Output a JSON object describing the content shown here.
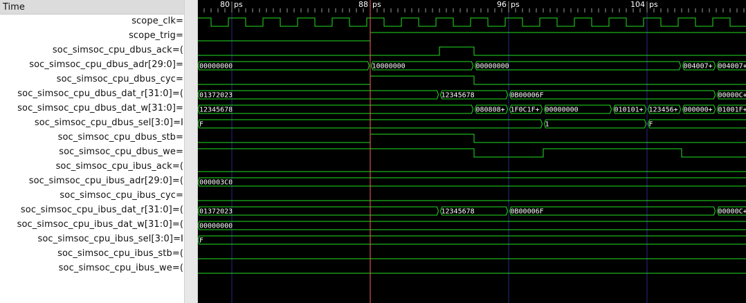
{
  "header": {
    "title": "Time"
  },
  "time_axis": {
    "unit": "ps",
    "major_labels": [
      {
        "time": 80,
        "label": "80"
      },
      {
        "time": 88,
        "label": "88"
      },
      {
        "time": 96,
        "label": "96"
      },
      {
        "time": 104,
        "label": "104"
      }
    ]
  },
  "marker_time": 88,
  "colors": {
    "wave": "#22e022",
    "marker": "#ff6060",
    "grid": "#2a2a80",
    "background": "#000000"
  },
  "signals": [
    {
      "name": "scope_clk",
      "suffix": "=",
      "type": "clock",
      "period": 2,
      "first_rise": 76.8
    },
    {
      "name": "scope_trig",
      "suffix": "=",
      "type": "bit",
      "initial": 0,
      "transitions": [
        {
          "t": 88,
          "v": 1
        }
      ]
    },
    {
      "name": "soc_simsoc_cpu_dbus_ack",
      "suffix": "=(",
      "type": "bit",
      "initial": 0,
      "transitions": [
        {
          "t": 92,
          "v": 1
        },
        {
          "t": 94,
          "v": 0
        }
      ]
    },
    {
      "name": "soc_simsoc_cpu_dbus_adr[29:0]",
      "suffix": "=",
      "type": "bus",
      "segments": [
        {
          "t": 78,
          "v": "00000000"
        },
        {
          "t": 88,
          "v": "10000000"
        },
        {
          "t": 94,
          "v": "00000000"
        },
        {
          "t": 106,
          "v": "004007+"
        },
        {
          "t": 108,
          "v": "004007+"
        }
      ]
    },
    {
      "name": "soc_simsoc_cpu_dbus_cyc",
      "suffix": "=",
      "type": "bit",
      "initial": 0,
      "transitions": [
        {
          "t": 88,
          "v": 1
        },
        {
          "t": 94,
          "v": 0
        }
      ]
    },
    {
      "name": "soc_simsoc_cpu_dbus_dat_r[31:0]",
      "suffix": "=(",
      "type": "bus",
      "segments": [
        {
          "t": 78,
          "v": "01372023"
        },
        {
          "t": 92,
          "v": "12345678"
        },
        {
          "t": 96,
          "v": "0B00006F"
        },
        {
          "t": 108,
          "v": "00000C+"
        }
      ]
    },
    {
      "name": "soc_simsoc_cpu_dbus_dat_w[31:0]",
      "suffix": "=",
      "type": "bus",
      "segments": [
        {
          "t": 78,
          "v": "12345678"
        },
        {
          "t": 94,
          "v": "080808+"
        },
        {
          "t": 96,
          "v": "1F0C1F+"
        },
        {
          "t": 98,
          "v": "00000000"
        },
        {
          "t": 102,
          "v": "010101+"
        },
        {
          "t": 104,
          "v": "123456+"
        },
        {
          "t": 106,
          "v": "000000+"
        },
        {
          "t": 108,
          "v": "01001F+"
        }
      ]
    },
    {
      "name": "soc_simsoc_cpu_dbus_sel[3:0]",
      "suffix": "=I",
      "type": "bus",
      "segments": [
        {
          "t": 78,
          "v": "F"
        },
        {
          "t": 98,
          "v": "1"
        },
        {
          "t": 104,
          "v": "F"
        }
      ]
    },
    {
      "name": "soc_simsoc_cpu_dbus_stb",
      "suffix": "=",
      "type": "bit",
      "initial": 0,
      "transitions": [
        {
          "t": 88,
          "v": 1
        },
        {
          "t": 94,
          "v": 0
        }
      ]
    },
    {
      "name": "soc_simsoc_cpu_dbus_we",
      "suffix": "=",
      "type": "bit",
      "initial": 1,
      "transitions": [
        {
          "t": 94,
          "v": 0
        },
        {
          "t": 98,
          "v": 1
        },
        {
          "t": 106,
          "v": 0
        }
      ]
    },
    {
      "name": "soc_simsoc_cpu_ibus_ack",
      "suffix": "=(",
      "type": "bit",
      "initial": 0,
      "transitions": []
    },
    {
      "name": "soc_simsoc_cpu_ibus_adr[29:0]",
      "suffix": "=(",
      "type": "bus",
      "segments": [
        {
          "t": 78,
          "v": "000003C0"
        }
      ]
    },
    {
      "name": "soc_simsoc_cpu_ibus_cyc",
      "suffix": "=",
      "type": "bit",
      "initial": 0,
      "transitions": []
    },
    {
      "name": "soc_simsoc_cpu_ibus_dat_r[31:0]",
      "suffix": "=(",
      "type": "bus",
      "segments": [
        {
          "t": 78,
          "v": "01372023"
        },
        {
          "t": 92,
          "v": "12345678"
        },
        {
          "t": 96,
          "v": "0B00006F"
        },
        {
          "t": 108,
          "v": "00000C+"
        }
      ]
    },
    {
      "name": "soc_simsoc_cpu_ibus_dat_w[31:0]",
      "suffix": "=(",
      "type": "bus",
      "segments": [
        {
          "t": 78,
          "v": "00000000"
        }
      ]
    },
    {
      "name": "soc_simsoc_cpu_ibus_sel[3:0]",
      "suffix": "=I",
      "type": "bus",
      "segments": [
        {
          "t": 78,
          "v": "F"
        }
      ]
    },
    {
      "name": "soc_simsoc_cpu_ibus_stb",
      "suffix": "=(",
      "type": "bit",
      "initial": 0,
      "transitions": []
    },
    {
      "name": "soc_simsoc_cpu_ibus_we",
      "suffix": "=(",
      "type": "bit",
      "initial": 0,
      "transitions": []
    }
  ]
}
